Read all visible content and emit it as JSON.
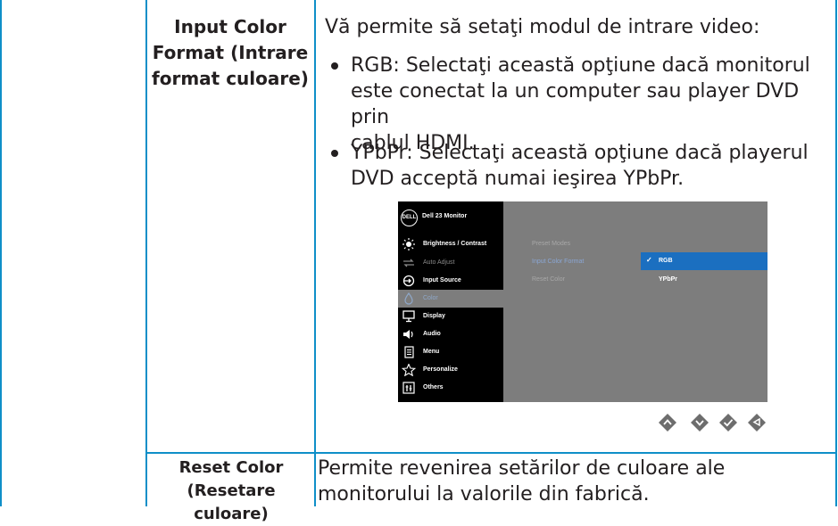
{
  "rows": [
    {
      "label_line1": "Input Color",
      "label_line2": "Format (Intrare",
      "label_line3": "format culoare)",
      "intro": "Vă permite să setaţi modul de intrare video:",
      "bullets": [
        {
          "line1": "RGB: Selectaţi această opţiune dacă monitorul",
          "line2": "este conectat la un computer sau player DVD prin",
          "line3": "cablul HDMI."
        },
        {
          "line1": "YPbPr: Selectaţi această opţiune dacă playerul",
          "line2": "DVD acceptă numai ieşirea YPbPr."
        }
      ]
    },
    {
      "label_line1": "Reset Color",
      "label_line2": "(Resetare culoare)",
      "desc_line1": "Permite revenirea setărilor de culoare ale",
      "desc_line2": "monitorului la valorile din fabrică."
    }
  ],
  "osd": {
    "logo": "DELL",
    "title": "Dell 23 Monitor",
    "menu": [
      {
        "label": "Brightness / Contrast",
        "icon": "brightness-icon",
        "state": "normal"
      },
      {
        "label": "Auto Adjust",
        "icon": "auto-adjust-icon",
        "state": "dim"
      },
      {
        "label": "Input Source",
        "icon": "input-source-icon",
        "state": "normal"
      },
      {
        "label": "Color",
        "icon": "color-icon",
        "state": "active"
      },
      {
        "label": "Display",
        "icon": "display-icon",
        "state": "normal"
      },
      {
        "label": "Audio",
        "icon": "audio-icon",
        "state": "normal"
      },
      {
        "label": "Menu",
        "icon": "menu-icon",
        "state": "normal"
      },
      {
        "label": "Personalize",
        "icon": "personalize-icon",
        "state": "normal"
      },
      {
        "label": "Others",
        "icon": "others-icon",
        "state": "normal"
      }
    ],
    "submenu": [
      "Preset Modes",
      "Input Color Format",
      "Reset Color"
    ],
    "options": [
      "RGB",
      "YPbPr"
    ],
    "selected_option": "RGB",
    "check": "✓"
  },
  "nav_buttons": [
    "up-button-icon",
    "down-button-icon",
    "ok-button-icon",
    "back-button-icon"
  ],
  "colors": {
    "accent": "#0f8fc8",
    "osd_highlight": "#1b6fc0",
    "nav_button": "#6d6d6d"
  }
}
